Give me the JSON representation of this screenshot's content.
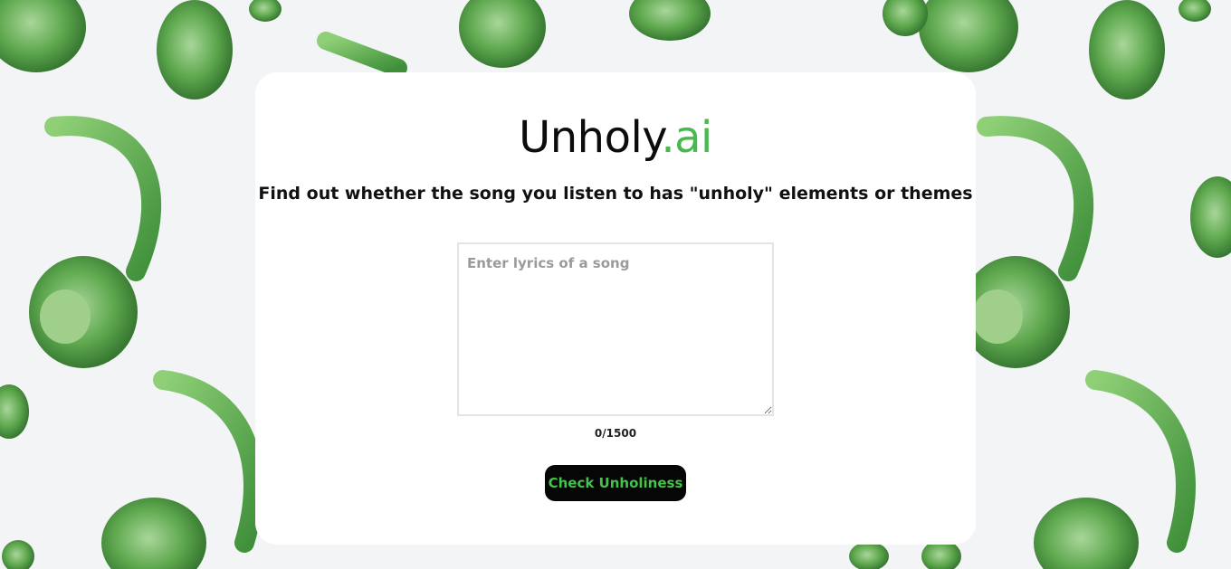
{
  "app": {
    "title_main": "Unholy",
    "title_suffix": ".ai",
    "subtitle": "Find out whether the song you listen to has \"unholy\" elements or themes"
  },
  "form": {
    "lyrics_placeholder": "Enter lyrics of a song",
    "lyrics_value": "",
    "counter": "0/1500",
    "submit_label": "Check Unholiness"
  },
  "colors": {
    "accent": "#48b84f",
    "button_bg": "#060606",
    "button_text": "#43c34a",
    "card_bg": "#ffffff",
    "page_bg": "#f2f4f6",
    "headphone_green": "#6fbf5a"
  },
  "background": {
    "pattern": "green-headphones-icon"
  }
}
